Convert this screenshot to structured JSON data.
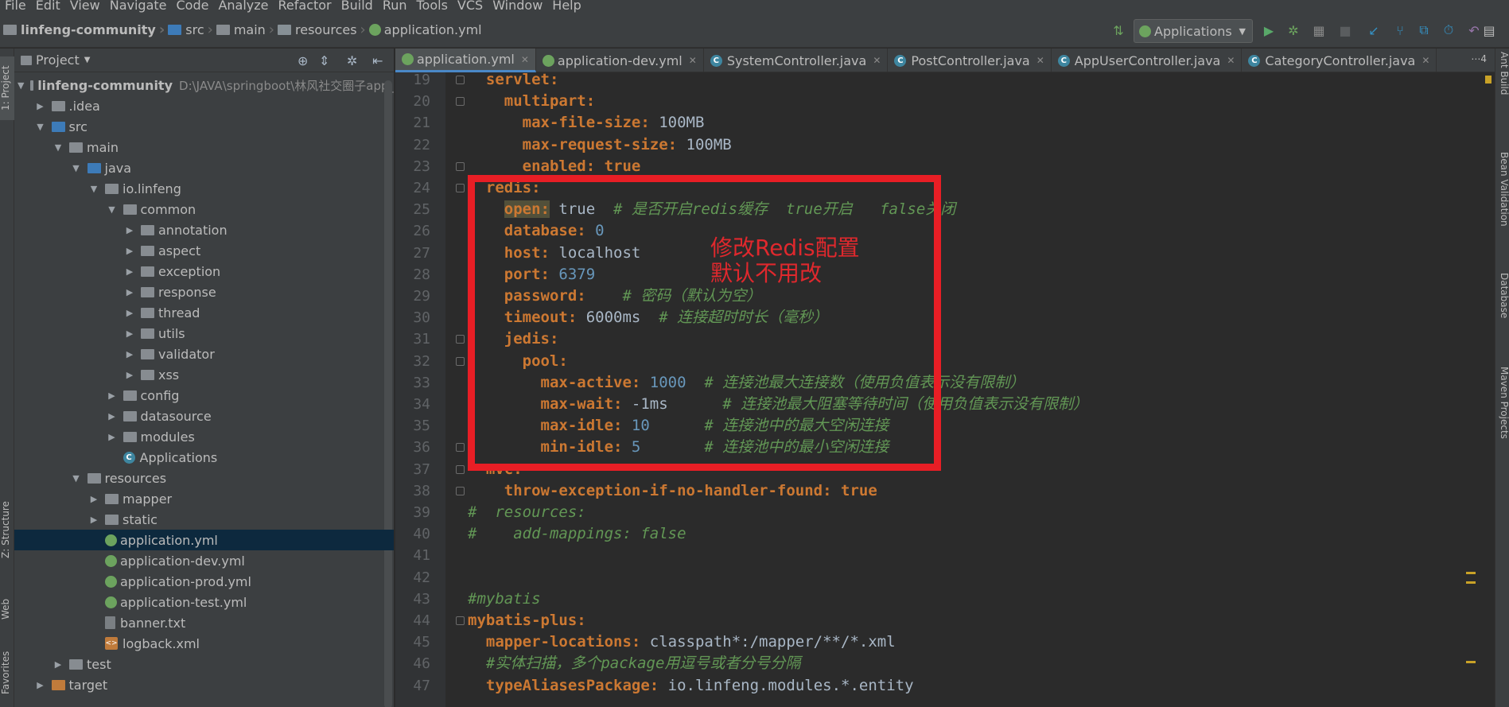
{
  "menu": [
    "File",
    "Edit",
    "View",
    "Navigate",
    "Code",
    "Analyze",
    "Refactor",
    "Build",
    "Run",
    "Tools",
    "VCS",
    "Window",
    "Help"
  ],
  "breadcrumb": [
    "linfeng-community",
    "src",
    "main",
    "resources",
    "application.yml"
  ],
  "run_config": "Applications",
  "project_panel": {
    "title": "Project",
    "root_name": "linfeng-community",
    "root_path": "D:\\JAVA\\springboot\\林风社交圈子app_",
    "tree": [
      {
        "label": ".idea",
        "depth": 1
      },
      {
        "label": "src",
        "depth": 1
      },
      {
        "label": "main",
        "depth": 2
      },
      {
        "label": "java",
        "depth": 3
      },
      {
        "label": "io.linfeng",
        "depth": 4
      },
      {
        "label": "common",
        "depth": 5
      },
      {
        "label": "annotation",
        "depth": 6
      },
      {
        "label": "aspect",
        "depth": 6
      },
      {
        "label": "exception",
        "depth": 6
      },
      {
        "label": "response",
        "depth": 6
      },
      {
        "label": "thread",
        "depth": 6
      },
      {
        "label": "utils",
        "depth": 6
      },
      {
        "label": "validator",
        "depth": 6
      },
      {
        "label": "xss",
        "depth": 6
      },
      {
        "label": "config",
        "depth": 5
      },
      {
        "label": "datasource",
        "depth": 5
      },
      {
        "label": "modules",
        "depth": 5
      },
      {
        "label": "Applications",
        "depth": 5
      },
      {
        "label": "resources",
        "depth": 3
      },
      {
        "label": "mapper",
        "depth": 4
      },
      {
        "label": "static",
        "depth": 4
      },
      {
        "label": "application.yml",
        "depth": 4
      },
      {
        "label": "application-dev.yml",
        "depth": 4
      },
      {
        "label": "application-prod.yml",
        "depth": 4
      },
      {
        "label": "application-test.yml",
        "depth": 4
      },
      {
        "label": "banner.txt",
        "depth": 4
      },
      {
        "label": "logback.xml",
        "depth": 4
      },
      {
        "label": "test",
        "depth": 2
      },
      {
        "label": "target",
        "depth": 1
      }
    ]
  },
  "side_tabs": {
    "left": [
      "1: Project",
      "Z: Structure",
      "Web",
      "Favorites"
    ],
    "right": [
      "Ant Build",
      "Bean Validation",
      "Database",
      "Maven Projects"
    ]
  },
  "editor_tabs": [
    "application.yml",
    "application-dev.yml",
    "SystemController.java",
    "PostController.java",
    "AppUserController.java",
    "CategoryController.java"
  ],
  "tabs_more": "⋯4",
  "code_lines": [
    {
      "n": "19",
      "parts": [
        [
          "  servlet:",
          "k"
        ]
      ]
    },
    {
      "n": "20",
      "parts": [
        [
          "    multipart:",
          "k"
        ]
      ]
    },
    {
      "n": "21",
      "parts": [
        [
          "      max-file-size: ",
          "k"
        ],
        [
          "100MB",
          "v"
        ]
      ]
    },
    {
      "n": "22",
      "parts": [
        [
          "      max-request-size: ",
          "k"
        ],
        [
          "100MB",
          "v"
        ]
      ]
    },
    {
      "n": "23",
      "parts": [
        [
          "      enabled: ",
          "k"
        ],
        [
          "true",
          "k"
        ]
      ]
    },
    {
      "n": "24",
      "parts": [
        [
          "  redis:",
          "k"
        ]
      ]
    },
    {
      "n": "25",
      "parts": [
        [
          "    ",
          "v"
        ],
        [
          "open:",
          "k hl"
        ],
        [
          " true  ",
          "v"
        ],
        [
          "# 是否开启redis缓存  true开启   false关闭",
          "c"
        ]
      ]
    },
    {
      "n": "26",
      "parts": [
        [
          "    database: ",
          "k"
        ],
        [
          "0",
          "n"
        ]
      ]
    },
    {
      "n": "27",
      "parts": [
        [
          "    host: ",
          "k"
        ],
        [
          "localhost",
          "v"
        ]
      ]
    },
    {
      "n": "28",
      "parts": [
        [
          "    port: ",
          "k"
        ],
        [
          "6379",
          "n"
        ]
      ]
    },
    {
      "n": "29",
      "parts": [
        [
          "    password: ",
          "k"
        ],
        [
          "   # 密码（默认为空）",
          "c"
        ]
      ]
    },
    {
      "n": "30",
      "parts": [
        [
          "    timeout: ",
          "k"
        ],
        [
          "6000ms  ",
          "v"
        ],
        [
          "# 连接超时时长（毫秒）",
          "c"
        ]
      ]
    },
    {
      "n": "31",
      "parts": [
        [
          "    jedis:",
          "k"
        ]
      ]
    },
    {
      "n": "32",
      "parts": [
        [
          "      pool:",
          "k"
        ]
      ]
    },
    {
      "n": "33",
      "parts": [
        [
          "        max-active: ",
          "k"
        ],
        [
          "1000",
          "n"
        ],
        [
          "  # 连接池最大连接数（使用负值表示没有限制）",
          "c"
        ]
      ]
    },
    {
      "n": "34",
      "parts": [
        [
          "        max-wait: ",
          "k"
        ],
        [
          "-1ms      ",
          "v"
        ],
        [
          "# 连接池最大阻塞等待时间（使用负值表示没有限制）",
          "c"
        ]
      ]
    },
    {
      "n": "35",
      "parts": [
        [
          "        max-idle: ",
          "k"
        ],
        [
          "10",
          "n"
        ],
        [
          "      # 连接池中的最大空闲连接",
          "c"
        ]
      ]
    },
    {
      "n": "36",
      "parts": [
        [
          "        min-idle: ",
          "k"
        ],
        [
          "5",
          "n"
        ],
        [
          "       # 连接池中的最小空闲连接",
          "c"
        ]
      ]
    },
    {
      "n": "37",
      "parts": [
        [
          "  mvc:",
          "k"
        ]
      ]
    },
    {
      "n": "38",
      "parts": [
        [
          "    throw-exception-if-no-handler-found: ",
          "k"
        ],
        [
          "true",
          "k"
        ]
      ]
    },
    {
      "n": "39",
      "parts": [
        [
          "#  resources:",
          "c"
        ]
      ]
    },
    {
      "n": "40",
      "parts": [
        [
          "#    add-mappings: false",
          "c"
        ]
      ]
    },
    {
      "n": "41",
      "parts": []
    },
    {
      "n": "42",
      "parts": []
    },
    {
      "n": "43",
      "parts": [
        [
          "#mybatis",
          "c"
        ]
      ]
    },
    {
      "n": "44",
      "parts": [
        [
          "mybatis-plus:",
          "k"
        ]
      ]
    },
    {
      "n": "45",
      "parts": [
        [
          "  mapper-locations: ",
          "k"
        ],
        [
          "classpath*:/mapper/**/*.xml",
          "v"
        ]
      ]
    },
    {
      "n": "46",
      "parts": [
        [
          "  #实体扫描，多个package用逗号或者分号分隔",
          "c"
        ]
      ]
    },
    {
      "n": "47",
      "parts": [
        [
          "  typeAliasesPackage: ",
          "k"
        ],
        [
          "io.linfeng.modules.*.entity",
          "v"
        ]
      ]
    }
  ],
  "annotation": {
    "line1": "修改Redis配置",
    "line2": "默认不用改",
    "color": "#e81e25"
  },
  "colors": {
    "keyword": "#cc7832",
    "number": "#6897bb",
    "comment": "#629755",
    "text": "#a9b7c6",
    "background": "#2b2b2b"
  }
}
